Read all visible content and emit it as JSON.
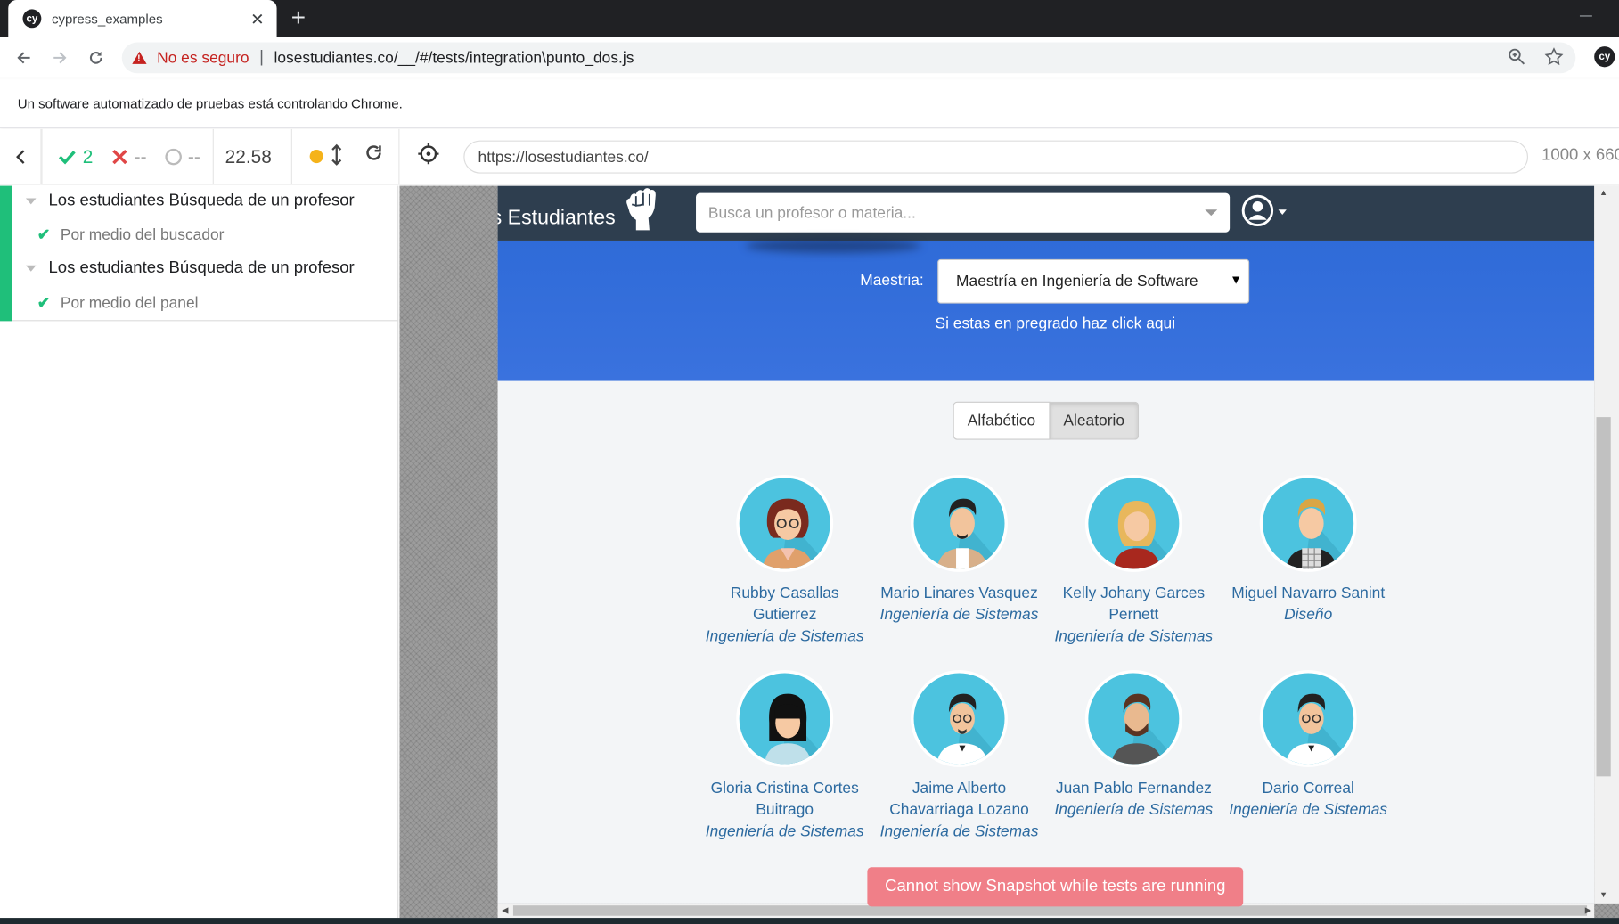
{
  "browser": {
    "tab_title": "cypress_examples",
    "tab_favicon": "cy",
    "new_tab": "+",
    "close_tab": "✕",
    "insecure_label": "No es seguro",
    "url": "losestudiantes.co/__/#/tests/integration\\punto_dos.js",
    "extension_label": "cy",
    "infobar_text": "Un software automatizado de pruebas está controlando Chrome."
  },
  "cypress": {
    "passed": "2",
    "failed": "--",
    "pending": "--",
    "duration": "22.58",
    "app_url": "https://losestudiantes.co/",
    "viewport": "1000 x 660",
    "status_color": "#f5b31a",
    "pass_color": "#1fbf7a",
    "fail_color": "#e04747",
    "suites": [
      {
        "title": "Los estudiantes Búsqueda de un profesor",
        "test": "Por medio del buscador"
      },
      {
        "title": "Los estudiantes Búsqueda de un profesor",
        "test": "Por medio del panel"
      }
    ],
    "snapshot_message": "Cannot show Snapshot while tests are running"
  },
  "site": {
    "brand": "s Estudiantes",
    "search_placeholder": "Busca un profesor o materia...",
    "maestria_label": "Maestria:",
    "maestria_selected": "Maestría en Ingeniería de Software",
    "pregrado_link": "Si estas en pregrado haz click aqui",
    "order_buttons": [
      "Alfabético",
      "Aleatorio"
    ],
    "professors": [
      {
        "name": "Rubby Casallas Gutierrez",
        "dept": "Ingeniería de Sistemas"
      },
      {
        "name": "Mario Linares Vasquez",
        "dept": "Ingeniería de Sistemas"
      },
      {
        "name": "Kelly Johany Garces Pernett",
        "dept": "Ingeniería de Sistemas"
      },
      {
        "name": "Miguel Navarro Sanint",
        "dept": "Diseño"
      },
      {
        "name": "Gloria Cristina Cortes Buitrago",
        "dept": "Ingeniería de Sistemas"
      },
      {
        "name": "Jaime Alberto Chavarriaga Lozano",
        "dept": "Ingeniería de Sistemas"
      },
      {
        "name": "Juan Pablo Fernandez",
        "dept": "Ingeniería de Sistemas"
      },
      {
        "name": "Dario Correal",
        "dept": "Ingeniería de Sistemas"
      }
    ]
  }
}
